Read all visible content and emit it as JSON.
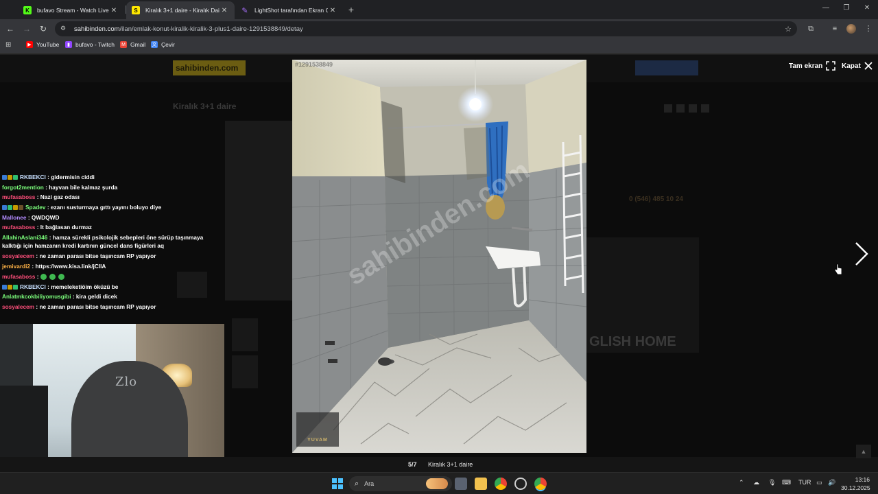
{
  "browser": {
    "tabs": [
      {
        "title": "bufavo Stream - Watch Live on",
        "favicon": "K",
        "favicon_color": "#53fc18",
        "active": false
      },
      {
        "title": "Kiralık 3+1 daire - Kiralık Daire",
        "favicon": "S",
        "favicon_color": "#ffe800",
        "active": true
      },
      {
        "title": "LightShot tarafından Ekran Gör",
        "favicon": "feather",
        "favicon_color": "#a970ff",
        "active": false
      }
    ],
    "url_host": "sahibinden.com",
    "url_path": "/ilan/emlak-konut-kiralik-kiralik-3-plus1-daire-1291538849/detay",
    "bookmarks": [
      {
        "label": "YouTube",
        "color": "#ff0000"
      },
      {
        "label": "bufavo - Twitch",
        "color": "#9146ff"
      },
      {
        "label": "Gmail",
        "color": "#ea4335"
      },
      {
        "label": "Çevir",
        "color": "#4285f4"
      }
    ]
  },
  "page_under": {
    "logo": "sahibinden.com",
    "title": "Kiralık 3+1 daire",
    "phone": "0 (546) 485 10 24",
    "banner": "GLISH HOME"
  },
  "lightbox": {
    "watermark_id": "#1291538849",
    "watermark_site": "sahibinden.com",
    "badge": "YUVAM",
    "fullscreen_label": "Tam ekran",
    "close_label": "Kapat",
    "counter": "5/7",
    "caption": "Kiralık 3+1 daire"
  },
  "chat": [
    {
      "user": "mufasaboss",
      "color": "#ff4f7b",
      "badges": [
        "#3a7bd5",
        "#c79a00",
        "#2fbf71"
      ],
      "msg": ": gidermisin ciddi",
      "user_override": "RKBEKCI",
      "user_color": "#c8e0ff"
    },
    {
      "user": "forgot2mention",
      "color": "#7cff7c",
      "badges": [],
      "msg": ": hayvan bile kalmaz şurda"
    },
    {
      "user": "mufasaboss",
      "color": "#ff4f7b",
      "badges": [],
      "msg": ": Nazi gaz odası"
    },
    {
      "user": "Spadev",
      "color": "#7cff7c",
      "badges": [
        "#3a7bd5",
        "#2fbf71",
        "#c79a00",
        "#6b4f2a"
      ],
      "msg": ": ezanı susturmaya gıttı yayını boluyo diye"
    },
    {
      "user": "Mallonee",
      "color": "#b48cff",
      "badges": [],
      "msg": ": QWDQWD"
    },
    {
      "user": "mufasaboss",
      "color": "#ff4f7b",
      "badges": [],
      "msg": ": It bağlasan durmaz"
    },
    {
      "user": "AllahinAslani346",
      "color": "#7cff7c",
      "badges": [],
      "msg": ": hamza sürekli psikolojik sebepleri öne sürüp taşınmaya"
    },
    {
      "user": "",
      "color": "#ffffff",
      "badges": [],
      "msg": "kalktığı için hamzanın kredi kartının güncel dans figürleri aq"
    },
    {
      "user": "sosyalecem",
      "color": "#ff4f7b",
      "badges": [],
      "msg": ": ne zaman parası bitse taşıncam RP yapıyor"
    },
    {
      "user": "jemivardi2",
      "color": "#ffb347",
      "badges": [],
      "msg": ": https://www.kisa.link/jCIlA"
    },
    {
      "user": "mufasaboss",
      "color": "#ff4f7b",
      "badges": [],
      "msg": ":",
      "emotes": 3
    },
    {
      "user": "RKBEKCI",
      "color": "#c8e0ff",
      "badges": [
        "#3a7bd5",
        "#c79a00",
        "#2fbf71"
      ],
      "msg": ": memeleketiöim öküzü be"
    },
    {
      "user": "Anlatmkcokbiliyomusgibi",
      "color": "#7cff7c",
      "badges": [],
      "msg": ": kira geldi dicek"
    },
    {
      "user": "sosyalecem",
      "color": "#ff4f7b",
      "badges": [],
      "msg": ": ne zaman parası bitse taşıncam RP yapıyor"
    }
  ],
  "webcam": {
    "chair_label": "Zlo"
  },
  "taskbar": {
    "search_placeholder": "Ara",
    "language": "TUR",
    "time": "13:16",
    "date": "30.12.2025"
  }
}
